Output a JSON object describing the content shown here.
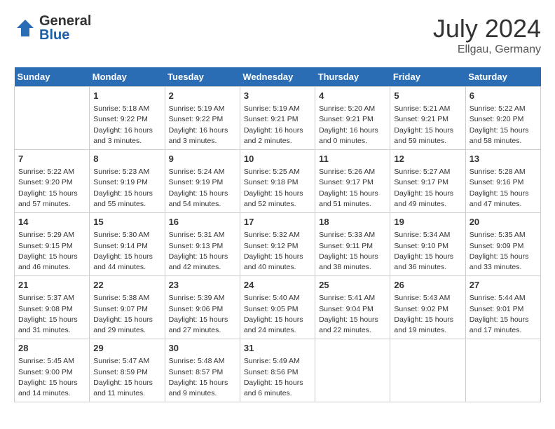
{
  "header": {
    "logo_general": "General",
    "logo_blue": "Blue",
    "month_year": "July 2024",
    "location": "Ellgau, Germany"
  },
  "days_of_week": [
    "Sunday",
    "Monday",
    "Tuesday",
    "Wednesday",
    "Thursday",
    "Friday",
    "Saturday"
  ],
  "weeks": [
    [
      {
        "day": "",
        "info": ""
      },
      {
        "day": "1",
        "info": "Sunrise: 5:18 AM\nSunset: 9:22 PM\nDaylight: 16 hours\nand 3 minutes."
      },
      {
        "day": "2",
        "info": "Sunrise: 5:19 AM\nSunset: 9:22 PM\nDaylight: 16 hours\nand 3 minutes."
      },
      {
        "day": "3",
        "info": "Sunrise: 5:19 AM\nSunset: 9:21 PM\nDaylight: 16 hours\nand 2 minutes."
      },
      {
        "day": "4",
        "info": "Sunrise: 5:20 AM\nSunset: 9:21 PM\nDaylight: 16 hours\nand 0 minutes."
      },
      {
        "day": "5",
        "info": "Sunrise: 5:21 AM\nSunset: 9:21 PM\nDaylight: 15 hours\nand 59 minutes."
      },
      {
        "day": "6",
        "info": "Sunrise: 5:22 AM\nSunset: 9:20 PM\nDaylight: 15 hours\nand 58 minutes."
      }
    ],
    [
      {
        "day": "7",
        "info": "Sunrise: 5:22 AM\nSunset: 9:20 PM\nDaylight: 15 hours\nand 57 minutes."
      },
      {
        "day": "8",
        "info": "Sunrise: 5:23 AM\nSunset: 9:19 PM\nDaylight: 15 hours\nand 55 minutes."
      },
      {
        "day": "9",
        "info": "Sunrise: 5:24 AM\nSunset: 9:19 PM\nDaylight: 15 hours\nand 54 minutes."
      },
      {
        "day": "10",
        "info": "Sunrise: 5:25 AM\nSunset: 9:18 PM\nDaylight: 15 hours\nand 52 minutes."
      },
      {
        "day": "11",
        "info": "Sunrise: 5:26 AM\nSunset: 9:17 PM\nDaylight: 15 hours\nand 51 minutes."
      },
      {
        "day": "12",
        "info": "Sunrise: 5:27 AM\nSunset: 9:17 PM\nDaylight: 15 hours\nand 49 minutes."
      },
      {
        "day": "13",
        "info": "Sunrise: 5:28 AM\nSunset: 9:16 PM\nDaylight: 15 hours\nand 47 minutes."
      }
    ],
    [
      {
        "day": "14",
        "info": "Sunrise: 5:29 AM\nSunset: 9:15 PM\nDaylight: 15 hours\nand 46 minutes."
      },
      {
        "day": "15",
        "info": "Sunrise: 5:30 AM\nSunset: 9:14 PM\nDaylight: 15 hours\nand 44 minutes."
      },
      {
        "day": "16",
        "info": "Sunrise: 5:31 AM\nSunset: 9:13 PM\nDaylight: 15 hours\nand 42 minutes."
      },
      {
        "day": "17",
        "info": "Sunrise: 5:32 AM\nSunset: 9:12 PM\nDaylight: 15 hours\nand 40 minutes."
      },
      {
        "day": "18",
        "info": "Sunrise: 5:33 AM\nSunset: 9:11 PM\nDaylight: 15 hours\nand 38 minutes."
      },
      {
        "day": "19",
        "info": "Sunrise: 5:34 AM\nSunset: 9:10 PM\nDaylight: 15 hours\nand 36 minutes."
      },
      {
        "day": "20",
        "info": "Sunrise: 5:35 AM\nSunset: 9:09 PM\nDaylight: 15 hours\nand 33 minutes."
      }
    ],
    [
      {
        "day": "21",
        "info": "Sunrise: 5:37 AM\nSunset: 9:08 PM\nDaylight: 15 hours\nand 31 minutes."
      },
      {
        "day": "22",
        "info": "Sunrise: 5:38 AM\nSunset: 9:07 PM\nDaylight: 15 hours\nand 29 minutes."
      },
      {
        "day": "23",
        "info": "Sunrise: 5:39 AM\nSunset: 9:06 PM\nDaylight: 15 hours\nand 27 minutes."
      },
      {
        "day": "24",
        "info": "Sunrise: 5:40 AM\nSunset: 9:05 PM\nDaylight: 15 hours\nand 24 minutes."
      },
      {
        "day": "25",
        "info": "Sunrise: 5:41 AM\nSunset: 9:04 PM\nDaylight: 15 hours\nand 22 minutes."
      },
      {
        "day": "26",
        "info": "Sunrise: 5:43 AM\nSunset: 9:02 PM\nDaylight: 15 hours\nand 19 minutes."
      },
      {
        "day": "27",
        "info": "Sunrise: 5:44 AM\nSunset: 9:01 PM\nDaylight: 15 hours\nand 17 minutes."
      }
    ],
    [
      {
        "day": "28",
        "info": "Sunrise: 5:45 AM\nSunset: 9:00 PM\nDaylight: 15 hours\nand 14 minutes."
      },
      {
        "day": "29",
        "info": "Sunrise: 5:47 AM\nSunset: 8:59 PM\nDaylight: 15 hours\nand 11 minutes."
      },
      {
        "day": "30",
        "info": "Sunrise: 5:48 AM\nSunset: 8:57 PM\nDaylight: 15 hours\nand 9 minutes."
      },
      {
        "day": "31",
        "info": "Sunrise: 5:49 AM\nSunset: 8:56 PM\nDaylight: 15 hours\nand 6 minutes."
      },
      {
        "day": "",
        "info": ""
      },
      {
        "day": "",
        "info": ""
      },
      {
        "day": "",
        "info": ""
      }
    ]
  ]
}
